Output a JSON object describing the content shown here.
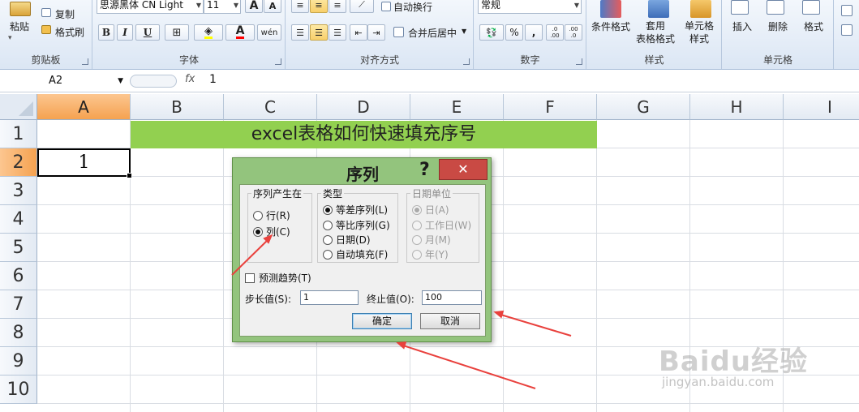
{
  "ribbon": {
    "clipboard": {
      "paste": "粘贴",
      "copy": "复制",
      "format_painter": "格式刷",
      "label": "剪贴板"
    },
    "font": {
      "font_name": "思源黑体 CN Light",
      "font_size": "11",
      "bold": "B",
      "italic": "I",
      "underline": "U",
      "grow": "A",
      "shrink": "A",
      "label": "字体"
    },
    "alignment": {
      "wrap_text": "自动换行",
      "merge_center": "合并后居中",
      "label": "对齐方式"
    },
    "number": {
      "format": "常规",
      "percent": "%",
      "comma": ",",
      "inc_decimal": ".0 .00",
      "dec_decimal": ".00 .0",
      "label": "数字"
    },
    "styles": {
      "conditional_format": "条件格式",
      "table_format": "套用\n表格格式",
      "cell_style": "单元格\n样式",
      "label": "样式"
    },
    "cells": {
      "insert": "插入",
      "delete": "删除",
      "format": "格式",
      "label": "单元格"
    }
  },
  "formula_bar": {
    "name_box": "A2",
    "fx": "fx",
    "value": "1"
  },
  "grid": {
    "columns": [
      "A",
      "B",
      "C",
      "D",
      "E",
      "F",
      "G",
      "H",
      "I"
    ],
    "rows": [
      "1",
      "2",
      "3",
      "4",
      "5",
      "6",
      "7",
      "8",
      "9",
      "10"
    ],
    "title_cell": "excel表格如何快速填充序号",
    "a2_value": "1"
  },
  "dialog": {
    "title": "序列",
    "help": "?",
    "close": "✕",
    "series_in": {
      "legend": "序列产生在",
      "options": [
        "行(R)",
        "列(C)"
      ],
      "selected": "列(C)"
    },
    "type": {
      "legend": "类型",
      "options": [
        "等差序列(L)",
        "等比序列(G)",
        "日期(D)",
        "自动填充(F)"
      ],
      "selected": "等差序列(L)"
    },
    "date_unit": {
      "legend": "日期单位",
      "options": [
        "日(A)",
        "工作日(W)",
        "月(M)",
        "年(Y)"
      ],
      "selected": "日(A)"
    },
    "trend": "预测趋势(T)",
    "step_label": "步长值(S):",
    "step_value": "1",
    "stop_label": "终止值(O):",
    "stop_value": "100",
    "ok": "确定",
    "cancel": "取消"
  },
  "watermark": {
    "brand": "Baidu经验",
    "url": "jingyan.baidu.com"
  },
  "colors": {
    "title_fill": "#92d050",
    "dialog_frame": "#93c47d",
    "close_button": "#c94a44",
    "annotation_arrow": "#e9413d",
    "selected_header": "#f5a250"
  }
}
